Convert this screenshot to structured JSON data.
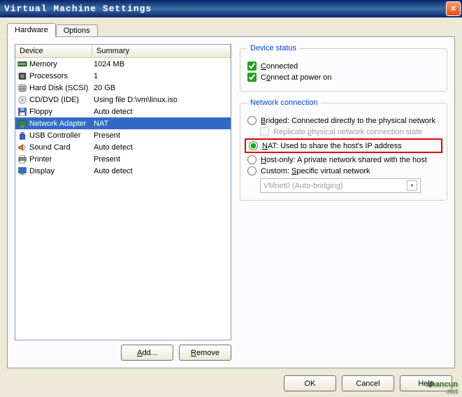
{
  "window": {
    "title": "Virtual Machine Settings"
  },
  "tabs": [
    {
      "label": "Hardware",
      "active": true
    },
    {
      "label": "Options",
      "active": false
    }
  ],
  "columns": {
    "device": "Device",
    "summary": "Summary"
  },
  "devices": [
    {
      "icon": "memory-icon",
      "name": "Memory",
      "summary": "1024 MB",
      "selected": false
    },
    {
      "icon": "cpu-icon",
      "name": "Processors",
      "summary": "1",
      "selected": false
    },
    {
      "icon": "hdd-icon",
      "name": "Hard Disk (SCSI)",
      "summary": "20 GB",
      "selected": false
    },
    {
      "icon": "cd-icon",
      "name": "CD/DVD (IDE)",
      "summary": "Using file D:\\vm\\linux.iso",
      "selected": false
    },
    {
      "icon": "floppy-icon",
      "name": "Floppy",
      "summary": "Auto detect",
      "selected": false
    },
    {
      "icon": "nic-icon",
      "name": "Network Adapter",
      "summary": "NAT",
      "selected": true
    },
    {
      "icon": "usb-icon",
      "name": "USB Controller",
      "summary": "Present",
      "selected": false
    },
    {
      "icon": "sound-icon",
      "name": "Sound Card",
      "summary": "Auto detect",
      "selected": false
    },
    {
      "icon": "printer-icon",
      "name": "Printer",
      "summary": "Present",
      "selected": false
    },
    {
      "icon": "display-icon",
      "name": "Display",
      "summary": "Auto detect",
      "selected": false
    }
  ],
  "buttons": {
    "add": "Add...",
    "remove": "Remove",
    "ok": "OK",
    "cancel": "Cancel",
    "help": "Help"
  },
  "device_status": {
    "legend": "Device status",
    "connected": {
      "label": "Connected",
      "checked": true
    },
    "connect_on": {
      "label": "Connect at power on",
      "checked": true
    }
  },
  "network": {
    "legend": "Network connection",
    "bridged": {
      "label": "Bridged: Connected directly to the physical network"
    },
    "replicate": {
      "label": "Replicate physical network connection state"
    },
    "nat": {
      "label": "NAT: Used to share the host's IP address"
    },
    "hostonly": {
      "label": "Host-only: A private network shared with the host"
    },
    "custom": {
      "label": "Custom: Specific virtual network"
    },
    "custom_value": "VMnet0 (Auto-bridging)"
  },
  "watermark": {
    "text": "shancun",
    "sub": ".net"
  }
}
